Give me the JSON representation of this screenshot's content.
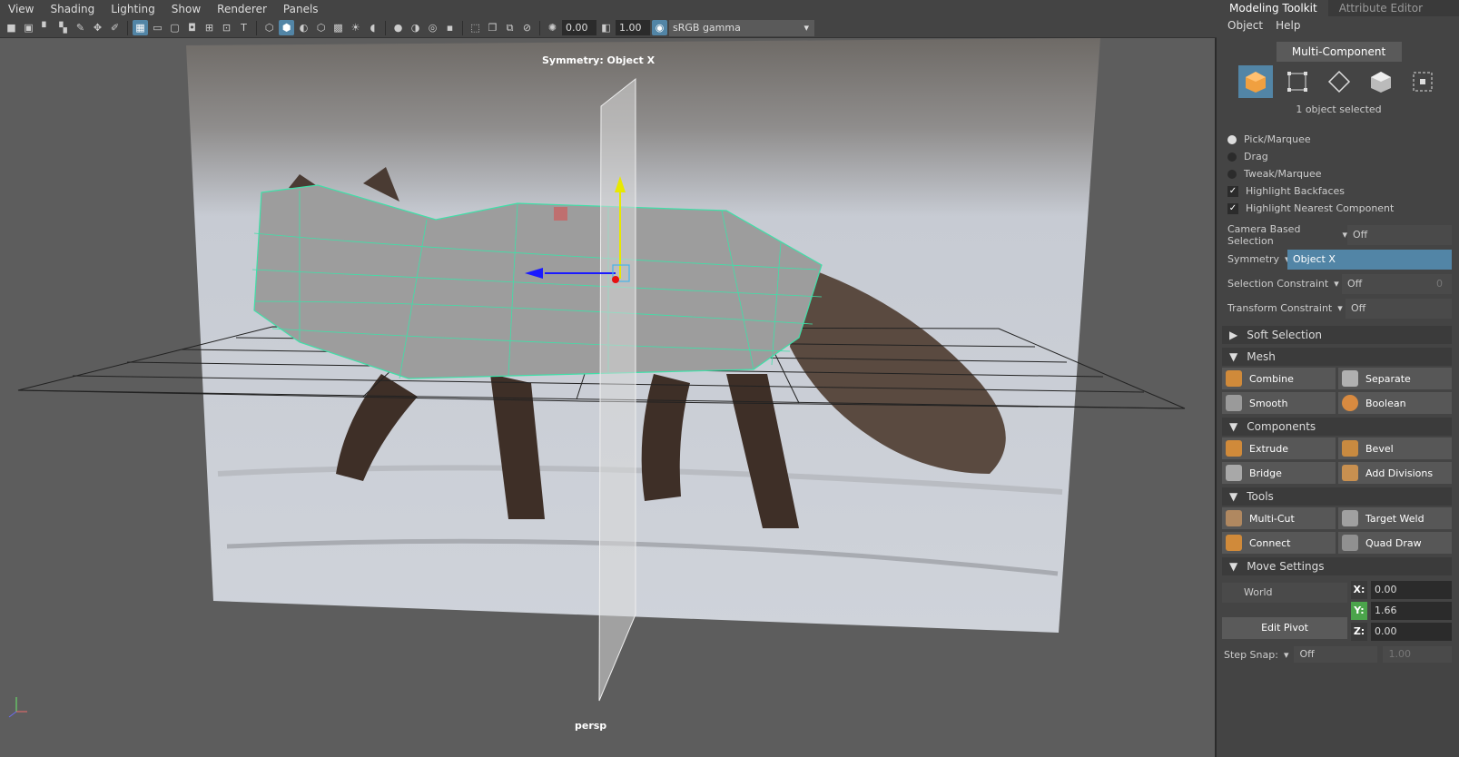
{
  "menubar": [
    "View",
    "Shading",
    "Lighting",
    "Show",
    "Renderer",
    "Panels"
  ],
  "toolbar": {
    "exposure": "0.00",
    "gamma": "1.00",
    "colorspace": "sRGB gamma"
  },
  "viewport": {
    "symmetry_label": "Symmetry: Object X",
    "camera_label": "persp"
  },
  "panel": {
    "tabs": [
      "Modeling Toolkit",
      "Attribute Editor"
    ],
    "menu": [
      "Object",
      "Help"
    ],
    "multi_component": "Multi-Component",
    "selection_info": "1 object selected",
    "radios": [
      "Pick/Marquee",
      "Drag",
      "Tweak/Marquee"
    ],
    "checks": [
      "Highlight Backfaces",
      "Highlight Nearest Component"
    ],
    "camera_based": {
      "label": "Camera Based Selection",
      "value": "Off"
    },
    "symmetry": {
      "label": "Symmetry",
      "value": "Object X"
    },
    "selection_constraint": {
      "label": "Selection Constraint",
      "value": "Off",
      "num": "0"
    },
    "transform_constraint": {
      "label": "Transform Constraint",
      "value": "Off"
    },
    "soft_selection": "Soft Selection",
    "mesh": {
      "title": "Mesh",
      "buttons": [
        "Combine",
        "Separate",
        "Smooth",
        "Boolean"
      ]
    },
    "components": {
      "title": "Components",
      "buttons": [
        "Extrude",
        "Bevel",
        "Bridge",
        "Add Divisions"
      ]
    },
    "tools": {
      "title": "Tools",
      "buttons": [
        "Multi-Cut",
        "Target Weld",
        "Connect",
        "Quad Draw"
      ]
    },
    "move_settings": {
      "title": "Move Settings",
      "space": "World",
      "x_label": "X:",
      "x": "0.00",
      "y_label": "Y:",
      "y": "1.66",
      "z_label": "Z:",
      "z": "0.00",
      "edit_pivot": "Edit Pivot",
      "step_snap_label": "Step Snap:",
      "step_snap": "Off",
      "step_value": "1.00"
    }
  }
}
